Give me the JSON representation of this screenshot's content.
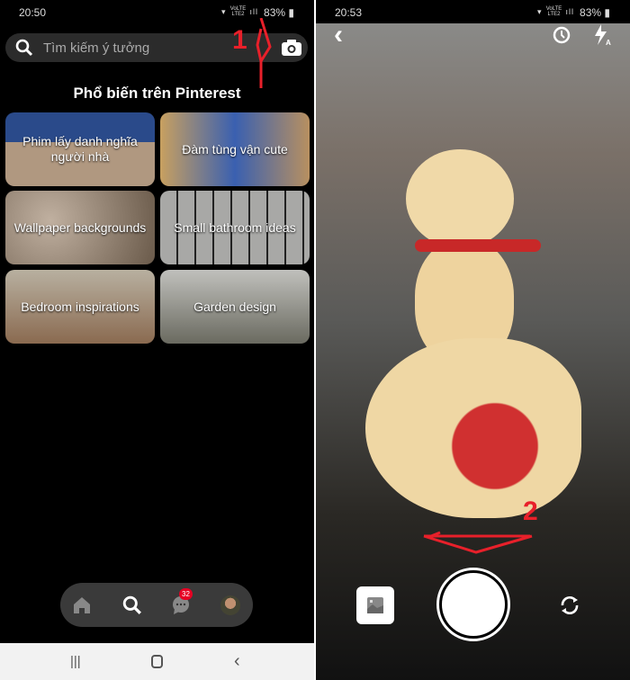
{
  "left_screen": {
    "status": {
      "time": "20:50",
      "signal": "VoLTE LTE2",
      "battery": "83%"
    },
    "search": {
      "placeholder": "Tìm kiếm ý tưởng"
    },
    "section_title": "Phổ biến trên Pinterest",
    "tiles": [
      {
        "label": "Phim lấy danh nghĩa người nhà",
        "color": "#7a6a5a"
      },
      {
        "label": "Đàm tùng vận cute",
        "color": "#4a6a9a"
      },
      {
        "label": "Wallpaper backgrounds",
        "color": "#8a7a6a"
      },
      {
        "label": "Small bathroom ideas",
        "color": "#8a8a88"
      },
      {
        "label": "Bedroom inspirations",
        "color": "#9a8a70"
      },
      {
        "label": "Garden design",
        "color": "#7a7a70"
      }
    ],
    "bottom_nav": {
      "items": [
        "home",
        "search",
        "messages",
        "profile"
      ],
      "messages_badge": "32"
    },
    "annotation": "1"
  },
  "right_screen": {
    "status": {
      "time": "20:53",
      "signal": "VoLTE LTE2",
      "battery": "83%"
    },
    "annotation": "2"
  },
  "colors": {
    "accent": "#e60023",
    "annotation": "#e8202a"
  }
}
